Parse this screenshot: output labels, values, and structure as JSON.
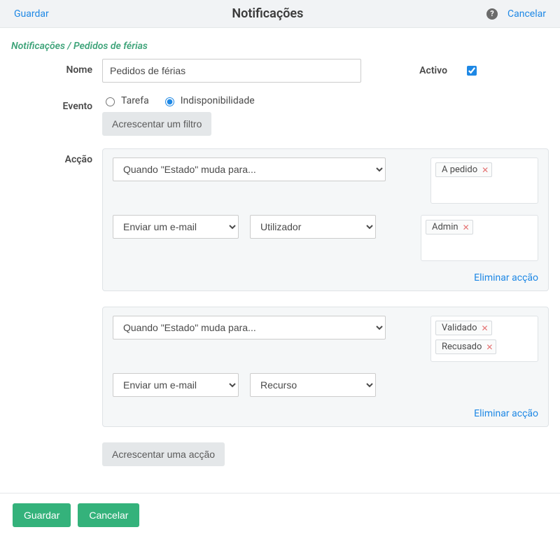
{
  "topbar": {
    "save": "Guardar",
    "title": "Notificações",
    "cancel": "Cancelar",
    "help_glyph": "?"
  },
  "breadcrumb": "Notificações / Pedidos de férias",
  "labels": {
    "name": "Nome",
    "active": "Activo",
    "event": "Evento",
    "action": "Acção"
  },
  "name_value": "Pedidos de férias",
  "active_checked": true,
  "event": {
    "option_task": "Tarefa",
    "option_unavailability": "Indisponibilidade",
    "selected": "unavailability",
    "add_filter": "Acrescentar um filtro"
  },
  "selects": {
    "when_state_changes": "Quando \"Estado\" muda para...",
    "send_email": "Enviar um e-mail",
    "user": "Utilizador",
    "resource": "Recurso"
  },
  "action1": {
    "state_tokens": [
      "A pedido"
    ],
    "target_tokens": [
      "Admin"
    ]
  },
  "action2": {
    "state_tokens": [
      "Validado",
      "Recusado"
    ]
  },
  "links": {
    "delete_action": "Eliminar acção"
  },
  "buttons": {
    "add_action": "Acrescentar uma acção",
    "save": "Guardar",
    "cancel": "Cancelar"
  }
}
